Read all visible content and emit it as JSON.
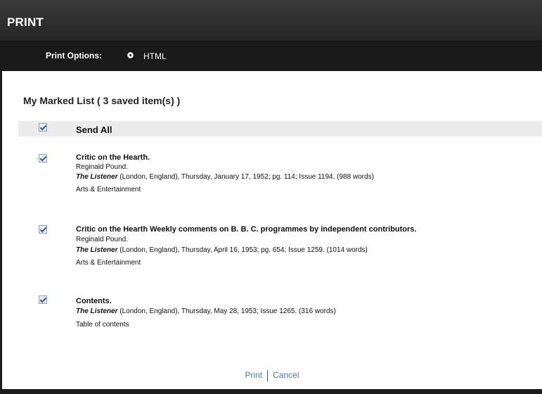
{
  "window": {
    "title": "PRINT"
  },
  "options": {
    "label": "Print Options:",
    "format": "HTML"
  },
  "list": {
    "heading": "My Marked List ( 3  saved item(s) )",
    "send_all": "Send All",
    "items": [
      {
        "title": "Critic on the Hearth.",
        "author": "Reginald Pound.",
        "publication": "The Listener",
        "citation": " (London, England),  Thursday,  January 17, 1952; pg. 114; Issue 1194.  (988 words)",
        "category": "Arts & Entertainment"
      },
      {
        "title": "Critic on the Hearth Weekly comments on B. B. C. programmes by independent contributors.",
        "author": "Reginald Pound.",
        "publication": "The Listener",
        "citation": " (London, England),  Thursday,  April 16, 1953; pg. 654; Issue 1259.  (1014 words)",
        "category": "Arts & Entertainment"
      },
      {
        "title": "Contents.",
        "publication": "The Listener",
        "citation": " (London, England),  Thursday,  May 28, 1953; Issue 1265.  (316 words)",
        "category": "Table of contents"
      }
    ]
  },
  "footer": {
    "print": "Print",
    "cancel": "Cancel"
  },
  "colors": {
    "link": "#4f7a9a",
    "header_bg": "#2f2f2f",
    "panel_bg": "#ffffff"
  }
}
